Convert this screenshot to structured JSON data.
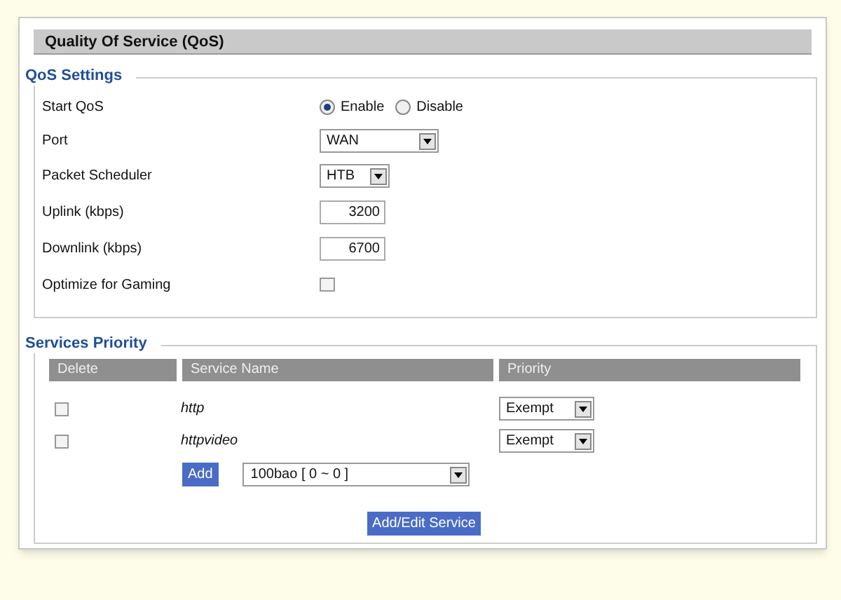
{
  "panel": {
    "title": "Quality Of Service (QoS)"
  },
  "qos_settings": {
    "legend": "QoS Settings",
    "rows": [
      {
        "kind": "radio",
        "label": "Start QoS",
        "options": [
          {
            "label": "Enable",
            "selected": true
          },
          {
            "label": "Disable",
            "selected": false
          }
        ]
      },
      {
        "kind": "select",
        "label": "Port",
        "value": "WAN"
      },
      {
        "kind": "select",
        "label": "Packet Scheduler",
        "value": "HTB"
      },
      {
        "kind": "input",
        "label": "Uplink (kbps)",
        "value": "3200"
      },
      {
        "kind": "input",
        "label": "Downlink (kbps)",
        "value": "6700"
      },
      {
        "kind": "checkbox",
        "label": "Optimize for Gaming",
        "checked": false
      }
    ]
  },
  "services_priority": {
    "legend": "Services Priority",
    "columns": [
      "Delete",
      "Service Name",
      "Priority"
    ],
    "rows": [
      {
        "checked": false,
        "service": "http",
        "priority": "Exempt"
      },
      {
        "checked": false,
        "service": "httpvideo",
        "priority": "Exempt"
      }
    ],
    "add_button": "Add",
    "add_select": "100bao [ 0 ~ 0 ]",
    "submit_button": "Add/Edit Service"
  }
}
